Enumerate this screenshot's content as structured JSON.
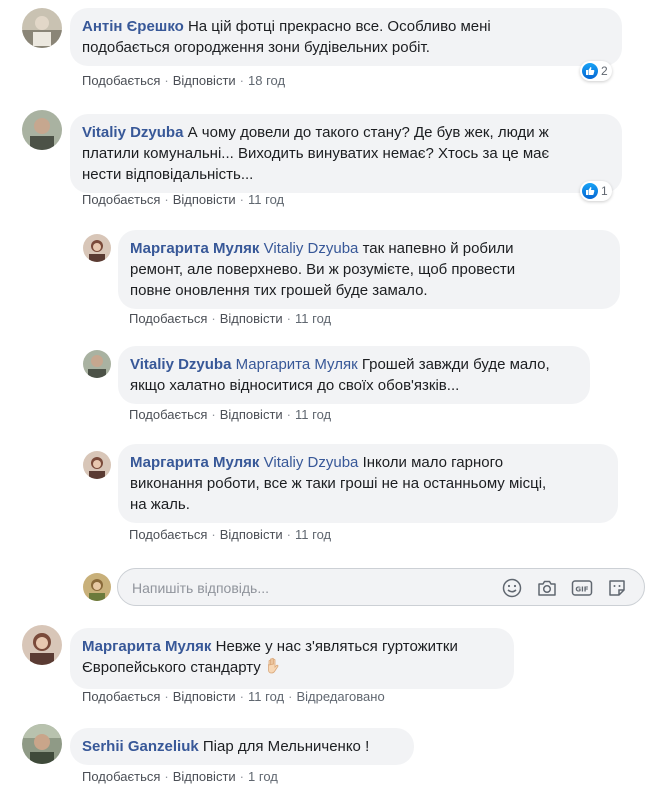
{
  "comments": [
    {
      "author": "Антін Єрешко",
      "text_line1": "На цій фотці прекрасно все. Особливо мені",
      "text_line2": "подобається огородження зони будівельних робіт.",
      "like": "Подобається",
      "reply": "Відповісти",
      "time": "18 год",
      "reactions": "2"
    },
    {
      "author": "Vitaliy Dzyuba",
      "text_line1": "А чому довели до такого стану? Де був жек, люди ж",
      "text_line2": "платили комунальні... Виходить винуватих немає? Хтось за це має",
      "text_line3": "нести відповідальність...",
      "like": "Подобається",
      "reply": "Відповісти",
      "time": "11 год",
      "reactions": "1",
      "replies": [
        {
          "author": "Маргарита Муляк",
          "mention": "Vitaliy Dzyuba",
          "text_line1": "так напевно й робили",
          "text_line2": "ремонт, але поверхнево. Ви ж розумієте, щоб провести",
          "text_line3": "повне оновлення тих грошей буде замало.",
          "like": "Подобається",
          "reply": "Відповісти",
          "time": "11 год"
        },
        {
          "author": "Vitaliy Dzyuba",
          "mention": "Маргарита Муляк",
          "text_line1": "Грошей завжди буде мало,",
          "text_line2": "якщо халатно відноситися до своїх обов'язків...",
          "like": "Подобається",
          "reply": "Відповісти",
          "time": "11 год"
        },
        {
          "author": "Маргарита Муляк",
          "mention": "Vitaliy Dzyuba",
          "text_line1": "Інколи мало гарного",
          "text_line2": "виконання роботи, все ж таки гроші не на останньому місці,",
          "text_line3": "на жаль.",
          "like": "Подобається",
          "reply": "Відповісти",
          "time": "11 год"
        }
      ],
      "reply_box": {
        "placeholder": "Напишіть відповідь..."
      }
    },
    {
      "author": "Маргарита Муляк",
      "text_line1": "Невже у нас з'являться гуртожитки",
      "text_line2": "Європейського стандарту",
      "like": "Подобається",
      "reply": "Відповісти",
      "time": "11 год",
      "edited": "Відредаговано"
    },
    {
      "author": "Serhii Ganzeliuk",
      "text_line1": "Піар для Мельниченко !",
      "like": "Подобається",
      "reply": "Відповісти",
      "time": "1 год"
    }
  ],
  "colors": {
    "name_link": "#385898",
    "bubble_bg": "#f2f3f5",
    "meta_text": "#606770",
    "like_blue": "#0867d2"
  },
  "icons": {
    "like_badge": "like-badge-icon",
    "emoji": "emoji-icon",
    "camera": "camera-icon",
    "gif": "gif-icon",
    "sticker": "sticker-icon",
    "hand_emoji": "hand-emoji-icon"
  }
}
